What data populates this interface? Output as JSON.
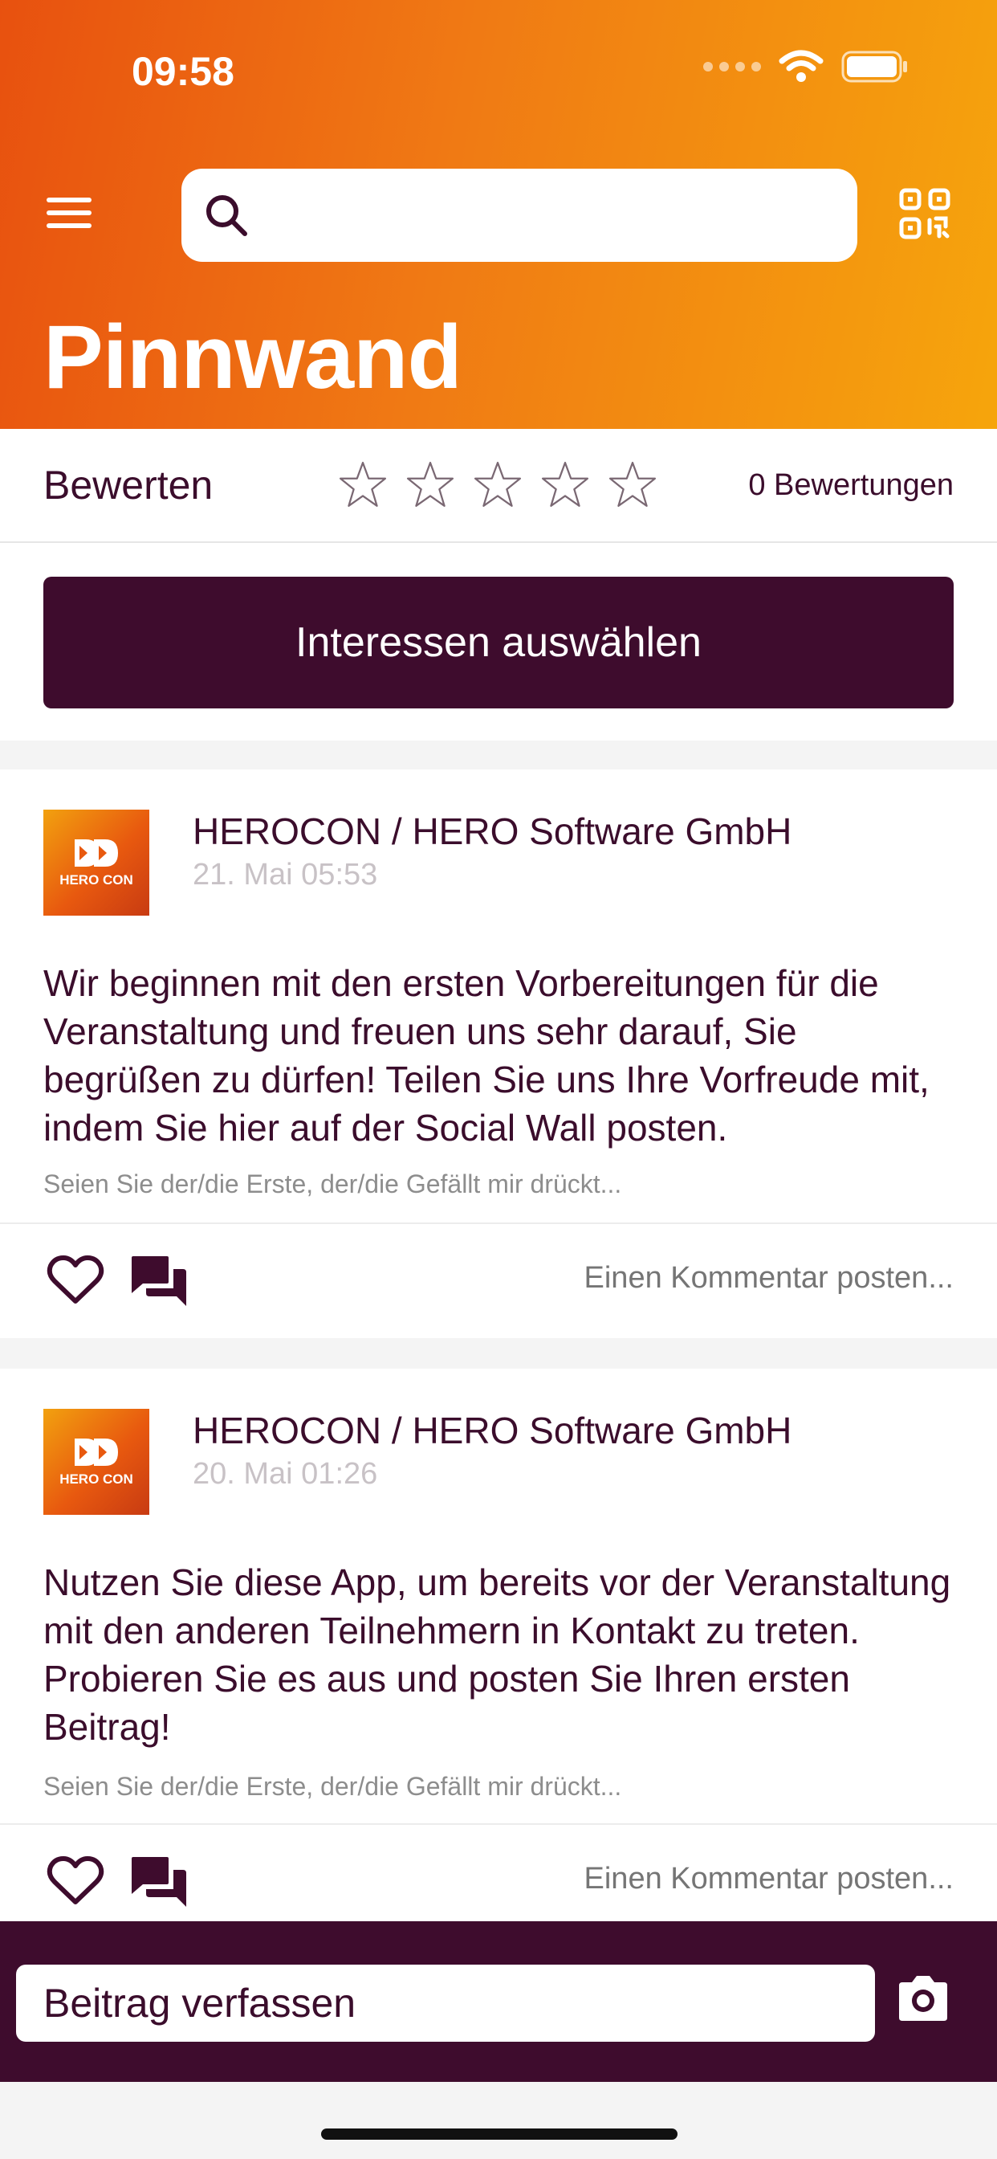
{
  "status_bar": {
    "time": "09:58"
  },
  "header": {
    "title": "Pinnwand",
    "search_placeholder": ""
  },
  "rating": {
    "label": "Bewerten",
    "stars_filled": 0,
    "stars_total": 5,
    "count_text": "0 Bewertungen"
  },
  "interests": {
    "button_label": "Interessen auswählen"
  },
  "posts": [
    {
      "author": "HEROCON / HERO Software GmbH",
      "date": "21. Mai 05:53",
      "body": "Wir beginnen mit den ersten Vorbereitungen für die Veranstaltung und freuen uns sehr darauf, Sie begrüßen zu dürfen! Teilen Sie uns Ihre Vorfreude mit, indem Sie hier auf der Social Wall posten.",
      "likes_text": "Seien Sie der/die Erste, der/die Gefällt mir drückt...",
      "comment_placeholder": "Einen Kommentar posten...",
      "avatar_label": "HERO CON"
    },
    {
      "author": "HEROCON / HERO Software GmbH",
      "date": "20. Mai 01:26",
      "body": "Nutzen Sie diese App, um bereits vor der Veranstaltung mit den anderen Teilnehmern in Kontakt zu treten. Probieren Sie es aus und posten Sie Ihren ersten Beitrag!",
      "likes_text": "Seien Sie der/die Erste, der/die Gefällt mir drückt...",
      "comment_placeholder": "Einen Kommentar posten...",
      "avatar_label": "HERO CON"
    }
  ],
  "compose": {
    "placeholder": "Beitrag verfassen"
  },
  "colors": {
    "brand_dark": "#3e0c2d",
    "gradient_start": "#e8510f",
    "gradient_end": "#f6a50c"
  },
  "icons": [
    "menu-icon",
    "search-icon",
    "qr-code-icon",
    "star-icon",
    "heart-icon",
    "comments-icon",
    "camera-icon",
    "wifi-icon",
    "battery-icon"
  ]
}
